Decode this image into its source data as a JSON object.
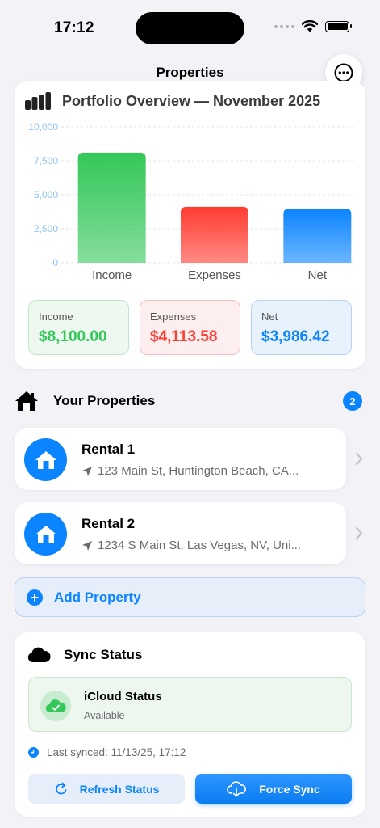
{
  "status_bar": {
    "time": "17:12"
  },
  "nav": {
    "title": "Properties",
    "more_icon": "ellipsis-circle-icon"
  },
  "overview": {
    "title": "Portfolio Overview — November 2025",
    "icon": "chart-bars-icon",
    "summary": [
      {
        "label": "Income",
        "value": "$8,100.00",
        "color": "#34c759"
      },
      {
        "label": "Expenses",
        "value": "$4,113.58",
        "color": "#ff3b30"
      },
      {
        "label": "Net",
        "value": "$3,986.42",
        "color": "#0a84ff"
      }
    ]
  },
  "chart_data": {
    "type": "bar",
    "categories": [
      "Income",
      "Expenses",
      "Net"
    ],
    "values": [
      8100.0,
      4113.58,
      3986.42
    ],
    "colors": [
      "#34c759",
      "#ff3b30",
      "#0a84ff"
    ],
    "ylim": [
      0,
      10000
    ],
    "yticks": [
      0,
      2500,
      5000,
      7500,
      10000
    ],
    "ytick_labels": [
      "0",
      "2,500",
      "5,000",
      "7,500",
      "10,000"
    ],
    "grid": true,
    "title": "",
    "xlabel": "",
    "ylabel": ""
  },
  "properties_section": {
    "title": "Your Properties",
    "count": "2",
    "icon": "house-icon"
  },
  "properties": [
    {
      "name": "Rental 1",
      "address": "123 Main St, Huntington Beach, CA...",
      "icon": "house-icon"
    },
    {
      "name": "Rental 2",
      "address": "1234 S Main St, Las Vegas, NV, Uni...",
      "icon": "house-icon"
    }
  ],
  "add_property": {
    "label": "Add Property"
  },
  "sync": {
    "title": "Sync Status",
    "icloud_title": "iCloud Status",
    "icloud_status": "Available",
    "last_synced": "Last synced: 11/13/25, 17:12",
    "refresh_label": "Refresh Status",
    "force_label": "Force Sync"
  }
}
